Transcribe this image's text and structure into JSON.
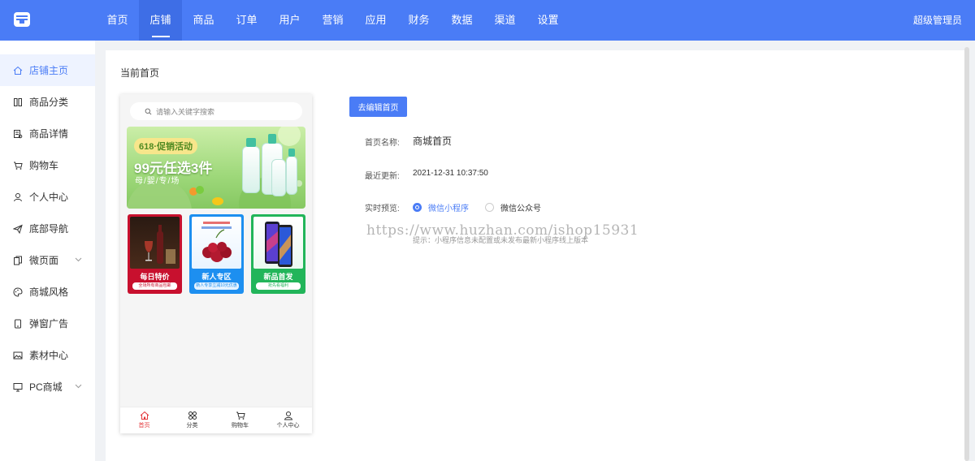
{
  "colors": {
    "primary": "#4a7cf6",
    "nav_active": "#3e6ee6",
    "sidebar_active_bg": "#eef3ff",
    "tab_active": "#e4393c"
  },
  "top_nav": {
    "items": [
      "首页",
      "店铺",
      "商品",
      "订单",
      "用户",
      "营销",
      "应用",
      "财务",
      "数据",
      "渠道",
      "设置"
    ],
    "active": "店铺",
    "user_label": "超级管理员"
  },
  "sidebar": {
    "items": [
      {
        "label": "店铺主页",
        "icon": "home-icon"
      },
      {
        "label": "商品分类",
        "icon": "category-icon"
      },
      {
        "label": "商品详情",
        "icon": "detail-icon"
      },
      {
        "label": "购物车",
        "icon": "cart-icon"
      },
      {
        "label": "个人中心",
        "icon": "user-icon"
      },
      {
        "label": "底部导航",
        "icon": "send-icon"
      },
      {
        "label": "微页面",
        "icon": "copy-icon"
      },
      {
        "label": "商城风格",
        "icon": "palette-icon"
      },
      {
        "label": "弹窗广告",
        "icon": "tablet-icon"
      },
      {
        "label": "素材中心",
        "icon": "image-icon"
      },
      {
        "label": "PC商城",
        "icon": "monitor-icon"
      }
    ],
    "active": "店铺主页"
  },
  "page": {
    "title": "当前首页"
  },
  "preview": {
    "search_placeholder": "请输入关键字搜索",
    "banner": {
      "tag": "618·促销活动",
      "headline": "99元任选3件",
      "subline": "母/婴/专/场"
    },
    "cards": [
      {
        "title": "每日特价",
        "subtitle": "全场所有商品包邮"
      },
      {
        "title": "新人专区",
        "subtitle": "新人专享立减10元优惠"
      },
      {
        "title": "新品首发",
        "subtitle": "抢先看福利"
      }
    ],
    "tabbar": [
      {
        "label": "首页",
        "icon": "home-icon",
        "active": true
      },
      {
        "label": "分类",
        "icon": "grid-icon",
        "active": false
      },
      {
        "label": "购物车",
        "icon": "cart-icon",
        "active": false
      },
      {
        "label": "个人中心",
        "icon": "user-icon",
        "active": false
      }
    ]
  },
  "info": {
    "edit_button": "去编辑首页",
    "name_label": "首页名称:",
    "name_value": "商城首页",
    "updated_label": "最近更新:",
    "updated_value": "2021-12-31 10:37:50",
    "preview_label": "实时预览:",
    "preview_options": [
      "微信小程序",
      "微信公众号"
    ],
    "preview_selected": "微信小程序",
    "tip": "提示：小程序信息未配置或未发布最新小程序线上版本",
    "watermark": "https://www.huzhan.com/ishop15931"
  }
}
